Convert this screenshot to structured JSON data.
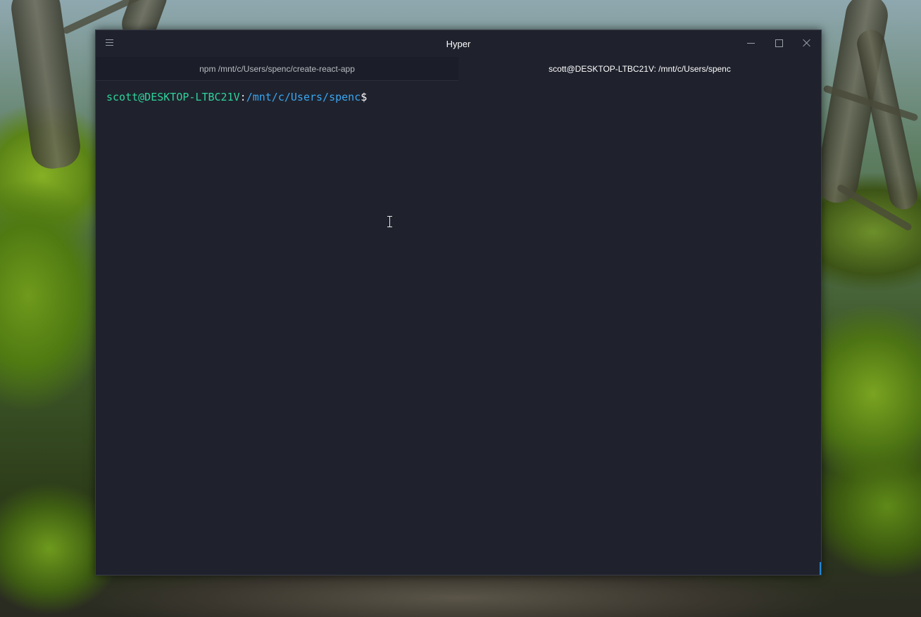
{
  "window": {
    "title": "Hyper"
  },
  "tabs": [
    {
      "label": "npm /mnt/c/Users/spenc/create-react-app",
      "active": false
    },
    {
      "label": "scott@DESKTOP-LTBC21V: /mnt/c/Users/spenc",
      "active": true
    }
  ],
  "terminal": {
    "prompt_user": "scott@DESKTOP-LTBC21V",
    "prompt_sep": ":",
    "prompt_path": "/mnt/c/Users/spenc",
    "prompt_symbol": "$"
  },
  "icons": {
    "menu": "hamburger-menu-icon",
    "minimize": "minimize-icon",
    "maximize": "maximize-icon",
    "close": "close-icon",
    "cursor": "text-cursor-icon"
  },
  "colors": {
    "terminal_bg": "#1f222d",
    "prompt_user": "#2fd39a",
    "prompt_path": "#3aa6f0",
    "accent": "#1e88d8"
  }
}
